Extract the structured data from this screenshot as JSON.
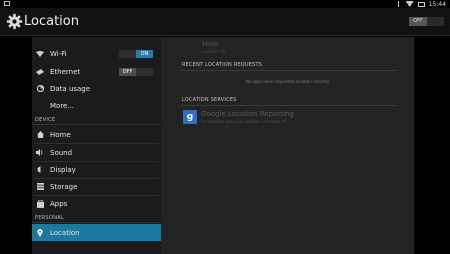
{
  "statusbar": {
    "time": "15:44"
  },
  "actionbar": {
    "title": "Location",
    "toggle_label": "OFF"
  },
  "sidebar": {
    "items": [
      {
        "label": "Wi-Fi",
        "toggle": "ON"
      },
      {
        "label": "Ethernet",
        "toggle": "OFF"
      },
      {
        "label": "Data usage"
      },
      {
        "label": "More..."
      }
    ],
    "device_header": "DEVICE",
    "device_items": [
      {
        "label": "Home"
      },
      {
        "label": "Sound"
      },
      {
        "label": "Display"
      },
      {
        "label": "Storage"
      },
      {
        "label": "Apps"
      }
    ],
    "personal_header": "PERSONAL",
    "personal_items": [
      {
        "label": "Location"
      }
    ]
  },
  "content": {
    "mode_title": "Mode",
    "mode_sub": "Location off",
    "recent_header": "RECENT LOCATION REQUESTS",
    "recent_empty": "No apps have requested location recently",
    "services_header": "LOCATION SERVICES",
    "service_title": "Google Location Reporting",
    "service_sub": "Unavailable because Location is turned off"
  },
  "colors": {
    "accent": "#1d78a0",
    "wifi_on": "#1f7fae"
  }
}
